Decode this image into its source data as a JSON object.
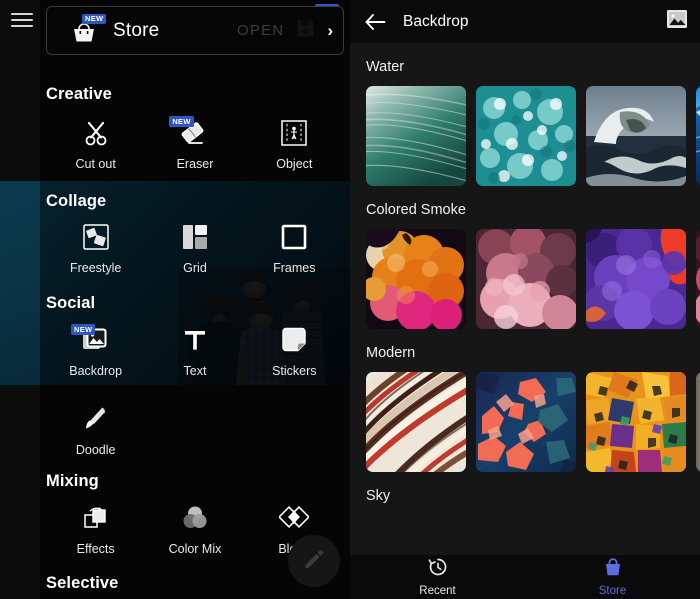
{
  "colors": {
    "badge_blue": "#2f57c4",
    "store_accent": "#5a6ee0",
    "panel_bg": "#161616",
    "appbar_bg": "#0a0a0a",
    "teal_strip": "#0b3a4e"
  },
  "left_panel": {
    "menu_icon": "hamburger-icon",
    "store_promo": {
      "icon": "shopping-basket-icon",
      "badge": "NEW",
      "label": "Store",
      "open_label": "OPEN",
      "save_icon": "save-icon",
      "chevron": "›"
    },
    "top_bar_basket": {
      "icon": "shopping-basket-icon",
      "badge": "NEW"
    },
    "sections": [
      {
        "title": "Creative",
        "tools": [
          {
            "label": "Cut out",
            "icon": "scissors-icon",
            "badge": null
          },
          {
            "label": "Eraser",
            "icon": "eraser-icon",
            "badge": "NEW"
          },
          {
            "label": "Object",
            "icon": "object-frame-icon",
            "badge": null
          }
        ]
      },
      {
        "title": "Collage",
        "tools": [
          {
            "label": "Freestyle",
            "icon": "freestyle-icon",
            "badge": null
          },
          {
            "label": "Grid",
            "icon": "grid-icon",
            "badge": null
          },
          {
            "label": "Frames",
            "icon": "frame-square-icon",
            "badge": null
          }
        ]
      },
      {
        "title": "Social",
        "tools": [
          {
            "label": "Backdrop",
            "icon": "image-backdrop-icon",
            "badge": "NEW"
          },
          {
            "label": "Text",
            "icon": "text-t-icon",
            "badge": null
          },
          {
            "label": "Stickers",
            "icon": "sticker-icon",
            "badge": null
          }
        ]
      },
      {
        "title": "",
        "tools": [
          {
            "label": "Doodle",
            "icon": "paintbrush-icon",
            "badge": null
          }
        ]
      },
      {
        "title": "Mixing",
        "tools": [
          {
            "label": "Effects",
            "icon": "effects-icon",
            "badge": null
          },
          {
            "label": "Color Mix",
            "icon": "color-mix-icon",
            "badge": null
          },
          {
            "label": "Blend",
            "icon": "blend-icon",
            "badge": null
          }
        ]
      },
      {
        "title": "Selective",
        "tools": []
      }
    ],
    "fab": {
      "icon": "pencil-edit-icon"
    }
  },
  "right_panel": {
    "appbar": {
      "back_icon": "arrow-left-icon",
      "title": "Backdrop",
      "gallery_icon": "image-picker-icon"
    },
    "categories": [
      {
        "title": "Water",
        "thumbs": [
          {
            "name": "water-streaks-teal"
          },
          {
            "name": "water-foam-turquoise"
          },
          {
            "name": "ocean-wave-breaking"
          },
          {
            "name": "blue-wave-sky"
          }
        ]
      },
      {
        "title": "Colored Smoke",
        "thumbs": [
          {
            "name": "orange-ink-smoke"
          },
          {
            "name": "pink-ink-smoke"
          },
          {
            "name": "purple-red-smoke"
          },
          {
            "name": "magenta-smoke-partial"
          }
        ]
      },
      {
        "title": "Modern",
        "thumbs": [
          {
            "name": "striped-swirl-paint"
          },
          {
            "name": "navy-coral-abstract"
          },
          {
            "name": "orange-mosaic-abstract"
          },
          {
            "name": "metallic-texture-partial"
          }
        ]
      },
      {
        "title": "Sky",
        "thumbs": []
      }
    ],
    "bottom_nav": [
      {
        "label": "Recent",
        "icon": "history-clock-icon",
        "active": false
      },
      {
        "label": "Store",
        "icon": "shopping-bag-icon",
        "active": true
      }
    ]
  }
}
